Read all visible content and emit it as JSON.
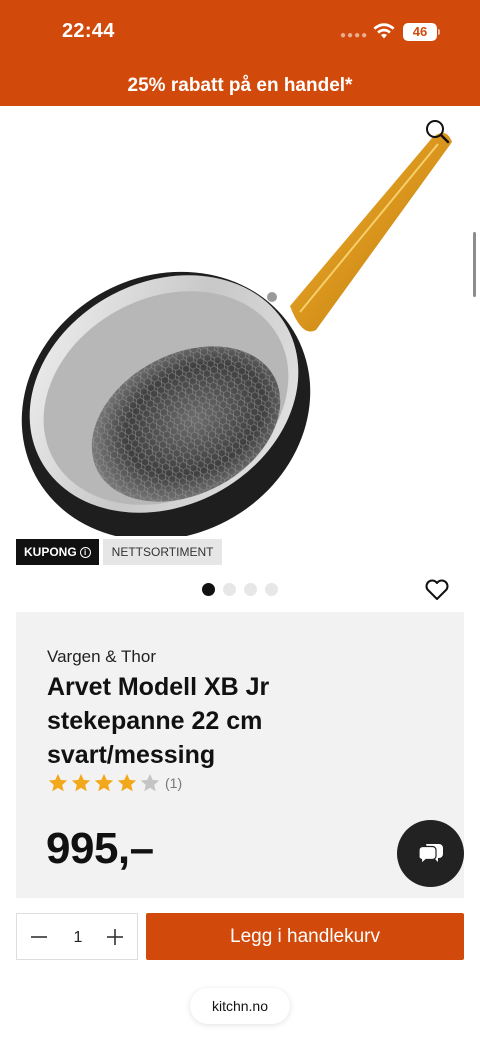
{
  "status_bar": {
    "time": "22:44",
    "battery": "46",
    "signal_icon": "signal-dots-icon",
    "wifi_icon": "wifi-icon",
    "background_color": "#d24a0b"
  },
  "promo": {
    "text": "25% rabatt på en handel*"
  },
  "product": {
    "image_icon": "frying-pan-image",
    "badges": [
      "KUPONG",
      "NETTSORTIMENT"
    ],
    "carousel": {
      "total": 4,
      "active_index": 0
    },
    "brand": "Vargen & Thor",
    "title": "Arvet Modell XB Jr stekepanne 22 cm svart/messing",
    "rating": {
      "value": 4,
      "max": 5,
      "count_label": "(1)"
    },
    "price": "995,–"
  },
  "cart": {
    "quantity": "1",
    "add_label": "Legg i handlekurv",
    "accent_color": "#d24a0b"
  },
  "browser": {
    "url": "kitchn.no"
  }
}
